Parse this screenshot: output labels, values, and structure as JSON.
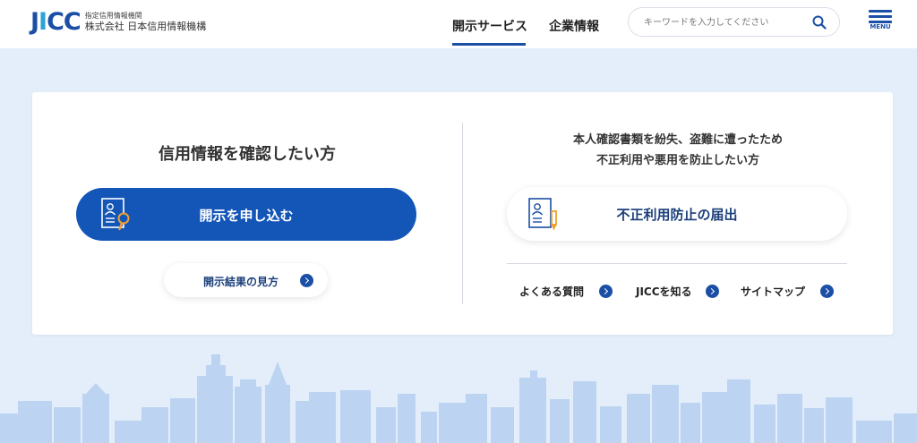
{
  "header": {
    "logo_mark": "JICC",
    "logo_subtitle": "指定信用情報機関",
    "logo_company": "株式会社 日本信用情報機構",
    "nav": [
      {
        "label": "開示サービス",
        "active": true
      },
      {
        "label": "企業情報",
        "active": false
      }
    ],
    "search_placeholder": "キーワードを入力してください",
    "menu_label": "MENU"
  },
  "left": {
    "heading": "信用情報を確認したい方",
    "primary_button": "開示を申し込む",
    "secondary_button": "開示結果の見方"
  },
  "right": {
    "heading_line1": "本人確認書類を紛失、盗難に遭ったため",
    "heading_line2": "不正利用や悪用を防止したい方",
    "report_button": "不正利用防止の届出",
    "links": [
      {
        "label": "よくある質問"
      },
      {
        "label": "JICCを知る"
      },
      {
        "label": "サイトマップ"
      }
    ]
  },
  "colors": {
    "brand_blue": "#1456b8",
    "nav_blue": "#1b4fa6",
    "accent_orange": "#f0a030",
    "page_bg": "#e3eefa",
    "skyline": "#bcd4f1"
  },
  "icons": {
    "search": "search-icon",
    "menu": "hamburger-menu-icon",
    "apply": "document-magnifier-icon",
    "report": "document-pen-icon",
    "arrow": "chevron-right-circle-icon"
  }
}
